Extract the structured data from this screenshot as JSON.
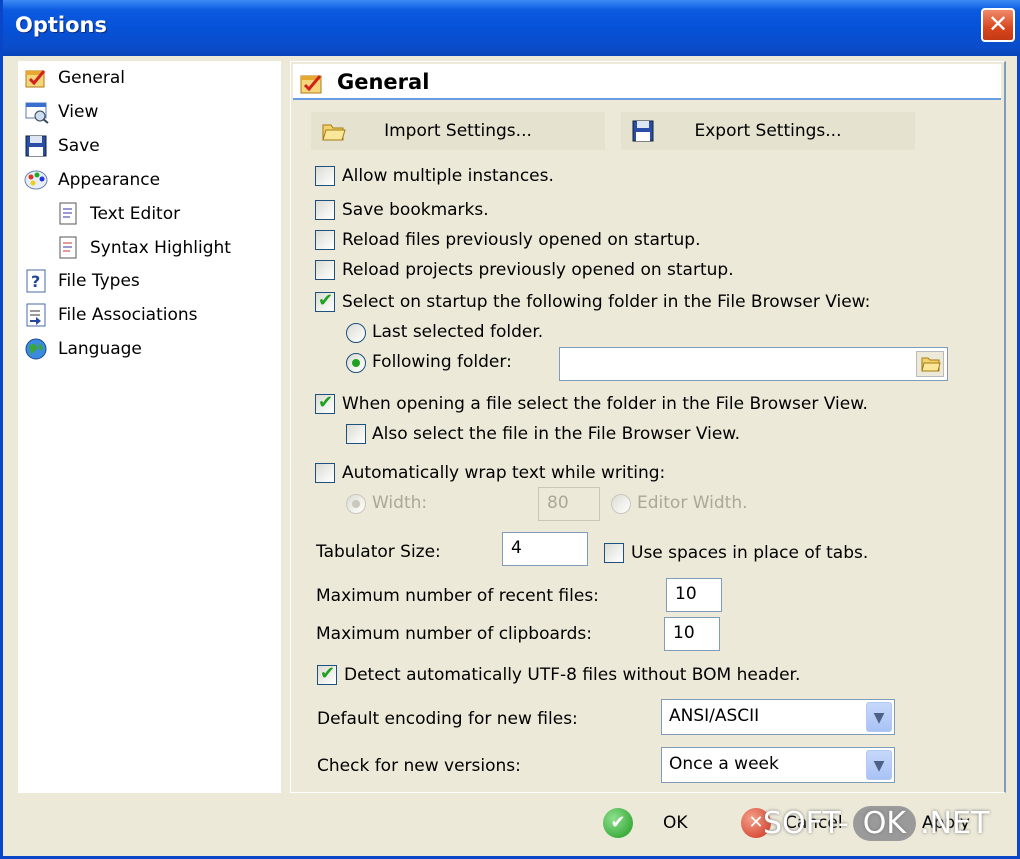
{
  "window": {
    "title": "Options",
    "close_glyph": "✕"
  },
  "tree": {
    "items": [
      {
        "label": "General",
        "icon": "checklist-icon"
      },
      {
        "label": "View",
        "icon": "view-icon"
      },
      {
        "label": "Save",
        "icon": "floppy-icon"
      },
      {
        "label": "Appearance",
        "icon": "palette-icon"
      },
      {
        "label": "Text Editor",
        "icon": "document-icon"
      },
      {
        "label": "Syntax Highlight",
        "icon": "document-icon"
      },
      {
        "label": "File Types",
        "icon": "help-icon"
      },
      {
        "label": "File Associations",
        "icon": "file-link-icon"
      },
      {
        "label": "Language",
        "icon": "globe-icon"
      }
    ]
  },
  "panel": {
    "title": "General",
    "import_label": "Import Settings...",
    "export_label": "Export Settings...",
    "allow_multiple": "Allow multiple instances.",
    "save_bookmarks": "Save bookmarks.",
    "reload_files": "Reload files previously opened on startup.",
    "reload_projects": "Reload projects previously opened on startup.",
    "select_folder": "Select on startup the following folder in the File Browser View:",
    "last_folder": "Last selected folder.",
    "following_folder": "Following folder:",
    "following_folder_value": "",
    "select_folder_on_open": "When opening a file select the folder in the File Browser View.",
    "also_select_file": "Also select the file in the File Browser View.",
    "auto_wrap": "Automatically wrap text while writing:",
    "width_label": "Width:",
    "width_value": "80",
    "editor_width": "Editor Width.",
    "tab_size_label": "Tabulator Size:",
    "tab_size_value": "4",
    "use_spaces": "Use spaces in place of tabs.",
    "max_recent_label": "Maximum number of recent files:",
    "max_recent_value": "10",
    "max_clipboards_label": "Maximum number of clipboards:",
    "max_clipboards_value": "10",
    "detect_utf8": "Detect automatically UTF-8 files without BOM header.",
    "encoding_label": "Default encoding for new files:",
    "encoding_value": "ANSI/ASCII",
    "check_versions_label": "Check for new versions:",
    "check_versions_value": "Once a week"
  },
  "footer": {
    "ok_label": "OK",
    "cancel_label": "Cancel",
    "apply_label": "Apply"
  },
  "watermark": {
    "left": "SOFT-",
    "mid": "OK",
    "right": ".NET"
  },
  "colors": {
    "titlebar": "#0552d8",
    "check": "#21a121",
    "face": "#ece9d8"
  }
}
